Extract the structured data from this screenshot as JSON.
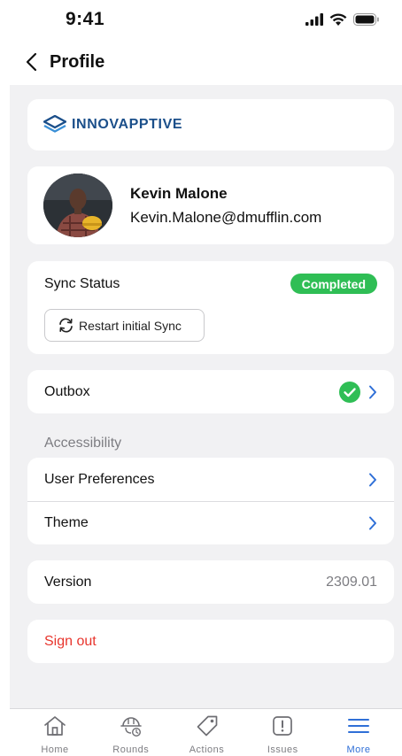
{
  "status_bar": {
    "time": "9:41"
  },
  "nav": {
    "title": "Profile"
  },
  "brand": {
    "name": "INNOVAPPTIVE",
    "color": "#1b4f8a"
  },
  "profile": {
    "name": "Kevin Malone",
    "email": "Kevin.Malone@dmufflin.com"
  },
  "sync": {
    "label": "Sync Status",
    "status": "Completed",
    "status_color": "#2fbe55",
    "restart_label": "Restart initial Sync"
  },
  "outbox": {
    "label": "Outbox",
    "status_icon": "check-circle-icon"
  },
  "accessibility": {
    "section_label": "Accessibility",
    "items": [
      {
        "label": "User Preferences"
      },
      {
        "label": "Theme"
      }
    ]
  },
  "version": {
    "label": "Version",
    "value": "2309.01"
  },
  "signout": {
    "label": "Sign out",
    "color": "#e8352d"
  },
  "tabs": [
    {
      "label": "Home",
      "icon": "home-icon",
      "active": false
    },
    {
      "label": "Rounds",
      "icon": "hard-hat-icon",
      "active": false
    },
    {
      "label": "Actions",
      "icon": "tag-icon",
      "active": false
    },
    {
      "label": "Issues",
      "icon": "alert-square-icon",
      "active": false
    },
    {
      "label": "More",
      "icon": "menu-icon",
      "active": true
    }
  ],
  "colors": {
    "accent": "#2f6fd7",
    "background": "#f1f1f3"
  }
}
